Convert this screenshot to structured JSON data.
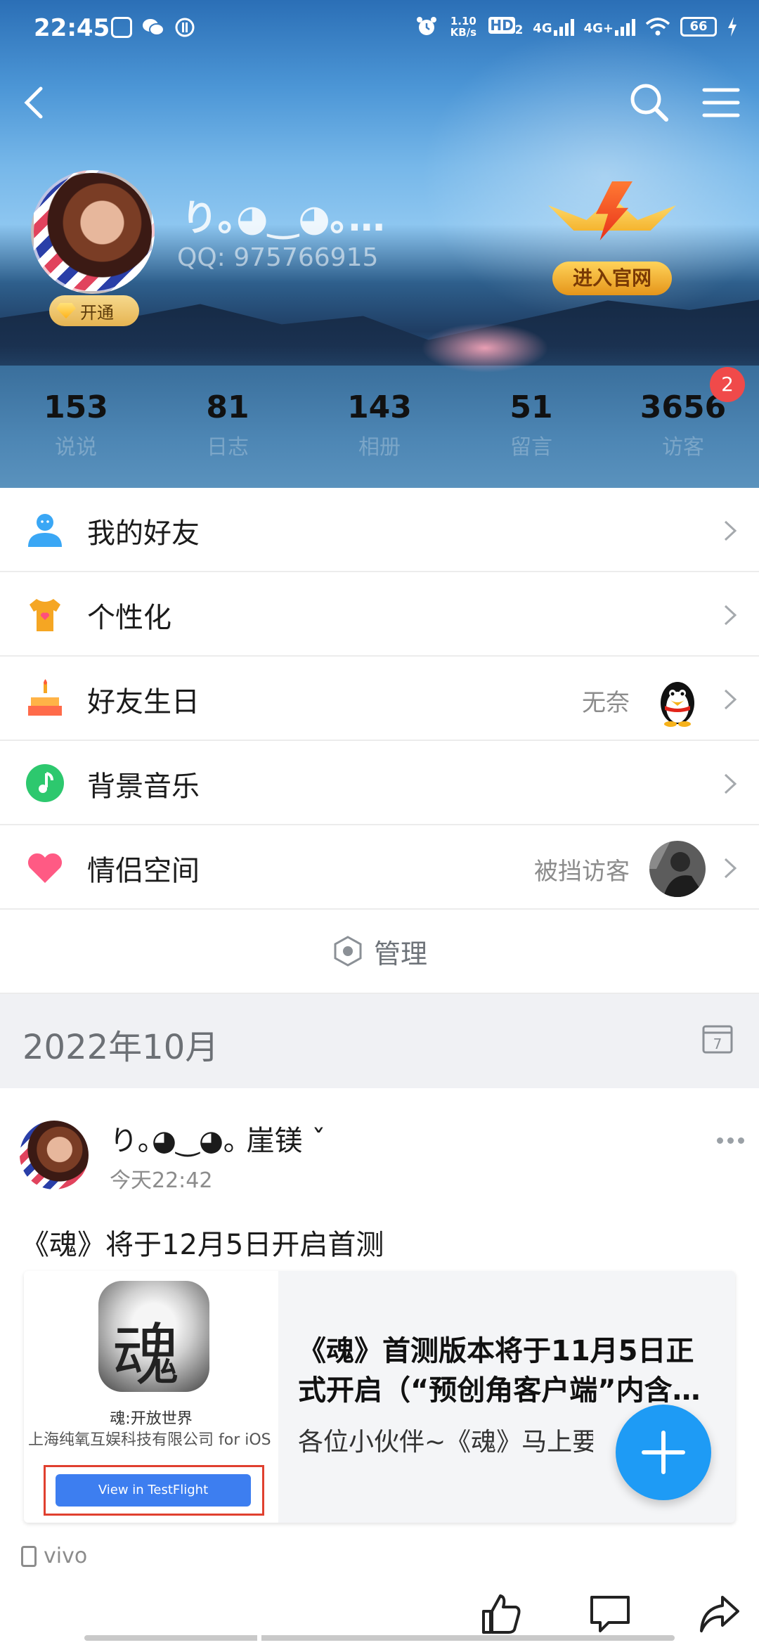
{
  "status": {
    "time": "22:45",
    "net_speed": "1.10 KB/s",
    "hd": "HD",
    "hd_sub": "2",
    "net1": "4G",
    "net2": "4G+",
    "battery": "66"
  },
  "profile": {
    "name": "り｡◕‿◕｡…",
    "qq": "QQ: 975766915",
    "vip_label": "开通",
    "official_label": "进入官网"
  },
  "stats": [
    {
      "value": "153",
      "label": "说说"
    },
    {
      "value": "81",
      "label": "日志"
    },
    {
      "value": "143",
      "label": "相册"
    },
    {
      "value": "51",
      "label": "留言"
    },
    {
      "value": "3656",
      "label": "访客",
      "badge": "2"
    }
  ],
  "menu": [
    {
      "title": "我的好友",
      "icon": "friends-icon",
      "color": "#3aa7f5"
    },
    {
      "title": "个性化",
      "icon": "tshirt-icon",
      "color": "#f5a623"
    },
    {
      "title": "好友生日",
      "icon": "birthday-cake-icon",
      "extra": "无奈",
      "color": "#f5a623"
    },
    {
      "title": "背景音乐",
      "icon": "music-note-icon",
      "color": "#2dc86e"
    },
    {
      "title": "情侣空间",
      "icon": "heart-icon",
      "extra": "被挡访客",
      "color": "#ff5a84"
    }
  ],
  "manage_label": "管理",
  "month": "2022年10月",
  "calendar_day": "7",
  "post": {
    "author": "り｡◕‿◕｡ 崖镁 ˇ",
    "time": "今天22:42",
    "text": "《魂》将于12月5日开启首测",
    "card": {
      "app_glyph": "魂",
      "app_name": "魂:开放世界",
      "company": "上海纯氧互娱科技有限公司 for iOS",
      "button": "View in TestFlight",
      "headline": "《魂》首测版本将于11月5日正式开启（“预创角客户端”内含…",
      "desc": "各位小伙伴~《魂》马上要开启"
    },
    "device": "vivo"
  },
  "colors": {
    "accent": "#1e9bf5",
    "badge": "#f04a4a"
  }
}
